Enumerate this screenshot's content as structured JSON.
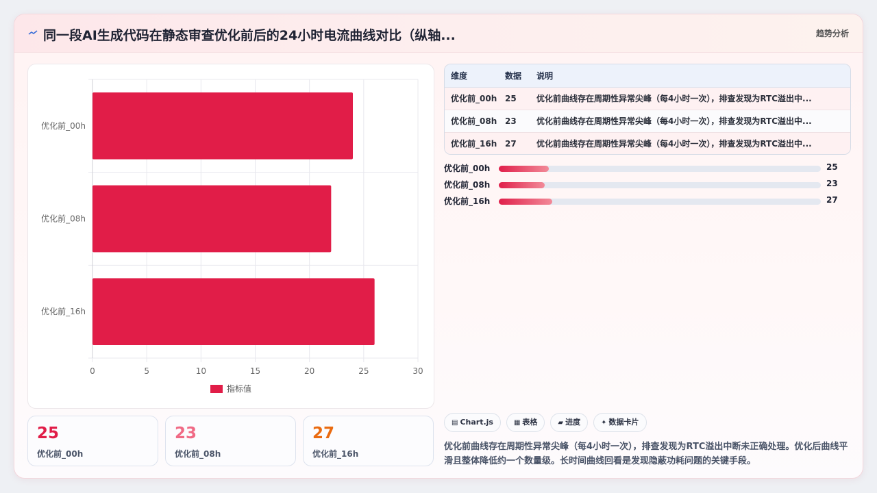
{
  "header": {
    "title": "同一段AI生成代码在静态审查优化前后的24小时电流曲线对比（纵轴...",
    "link": "趋势分析",
    "icon": "pulse-icon",
    "accent": "#e11d48"
  },
  "chart_data": {
    "type": "bar",
    "orientation": "horizontal",
    "categories": [
      "优化前_00h",
      "优化前_08h",
      "优化前_16h"
    ],
    "series": [
      {
        "name": "指标值",
        "values": [
          24,
          22,
          26
        ],
        "color": "#e11d48"
      }
    ],
    "xlim": [
      0,
      30
    ],
    "xticks": [
      "0",
      "5",
      "10",
      "15",
      "20",
      "25",
      "30"
    ],
    "grid": true,
    "legend": "bottom"
  },
  "stats": [
    {
      "value": "25",
      "label": "优化前_00h",
      "color": "#e11d48"
    },
    {
      "value": "23",
      "label": "优化前_08h",
      "color": "#f06a85"
    },
    {
      "value": "27",
      "label": "优化前_16h",
      "color": "#ea6b10"
    }
  ],
  "table": {
    "headers": [
      "维度",
      "数据",
      "说明"
    ],
    "rows": [
      [
        "优化前_00h",
        "25",
        "优化前曲线存在周期性异常尖峰（每4小时一次），排查发现为RTC溢出中..."
      ],
      [
        "优化前_08h",
        "23",
        "优化前曲线存在周期性异常尖峰（每4小时一次），排查发现为RTC溢出中..."
      ],
      [
        "优化前_16h",
        "27",
        "优化前曲线存在周期性异常尖峰（每4小时一次），排查发现为RTC溢出中..."
      ]
    ]
  },
  "progress": [
    {
      "label": "优化前_00h",
      "value": "25",
      "fraction": 0.155
    },
    {
      "label": "优化前_08h",
      "value": "23",
      "fraction": 0.142
    },
    {
      "label": "优化前_16h",
      "value": "27",
      "fraction": 0.167
    }
  ],
  "tags": [
    {
      "icon": "chart-icon",
      "glyph": "▤",
      "label": "Chart.js"
    },
    {
      "icon": "table-icon",
      "glyph": "▦",
      "label": "表格"
    },
    {
      "icon": "progress-icon",
      "glyph": "▰",
      "label": "进度"
    },
    {
      "icon": "card-icon",
      "glyph": "✦",
      "label": "数据卡片"
    }
  ],
  "description": "优化前曲线存在周期性异常尖峰（每4小时一次），排查发现为RTC溢出中断未正确处理。优化后曲线平滑且整体降低约一个数量级。长时间曲线回看是发现隐蔽功耗问题的关键手段。"
}
